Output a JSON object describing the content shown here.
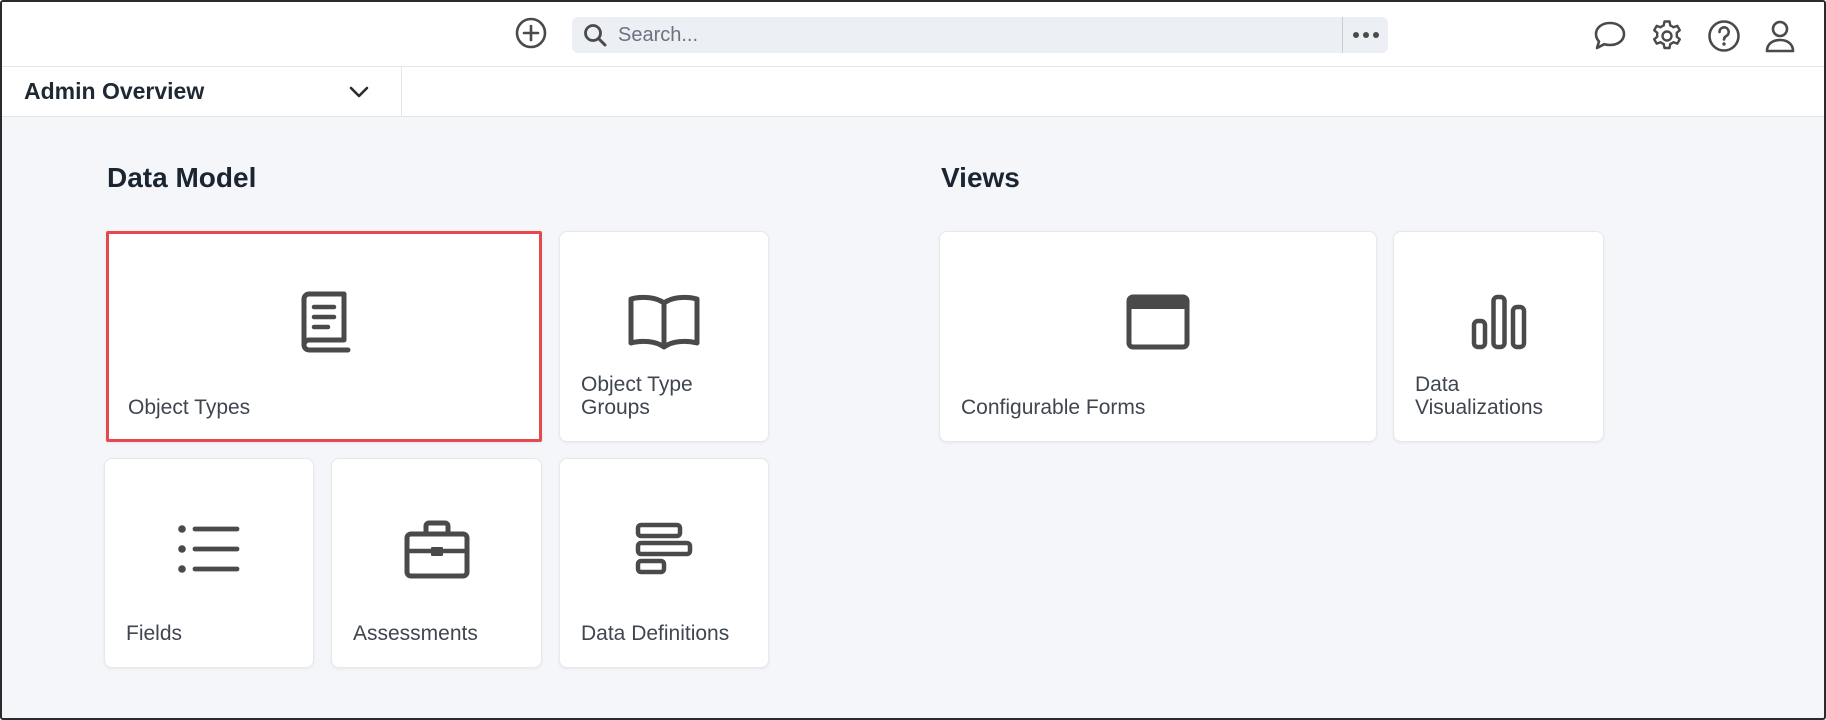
{
  "topbar": {
    "search": {
      "placeholder": "Search..."
    },
    "icons": [
      "add-circle-icon",
      "search-icon",
      "more-horizontal-icon",
      "chat-icon",
      "gear-icon",
      "help-icon",
      "user-icon"
    ]
  },
  "subbar": {
    "view_label": "Admin Overview"
  },
  "sections": {
    "data_model": {
      "title": "Data Model",
      "cards": [
        {
          "label": "Object Types",
          "icon": "book-icon",
          "selected": true
        },
        {
          "label": "Object Type Groups",
          "icon": "open-book-icon"
        },
        {
          "label": "Fields",
          "icon": "list-icon"
        },
        {
          "label": "Assessments",
          "icon": "briefcase-icon"
        },
        {
          "label": "Data Definitions",
          "icon": "align-left-bars-icon"
        }
      ]
    },
    "views": {
      "title": "Views",
      "cards": [
        {
          "label": "Configurable Forms",
          "icon": "browser-window-icon"
        },
        {
          "label": "Data Visualizations",
          "icon": "bar-chart-icon"
        }
      ]
    }
  },
  "colors": {
    "background": "#f5f6f9",
    "card": "#ffffff",
    "selected_border": "#e5484d",
    "icon": "#4a4a4a",
    "title": "#1b2431"
  }
}
